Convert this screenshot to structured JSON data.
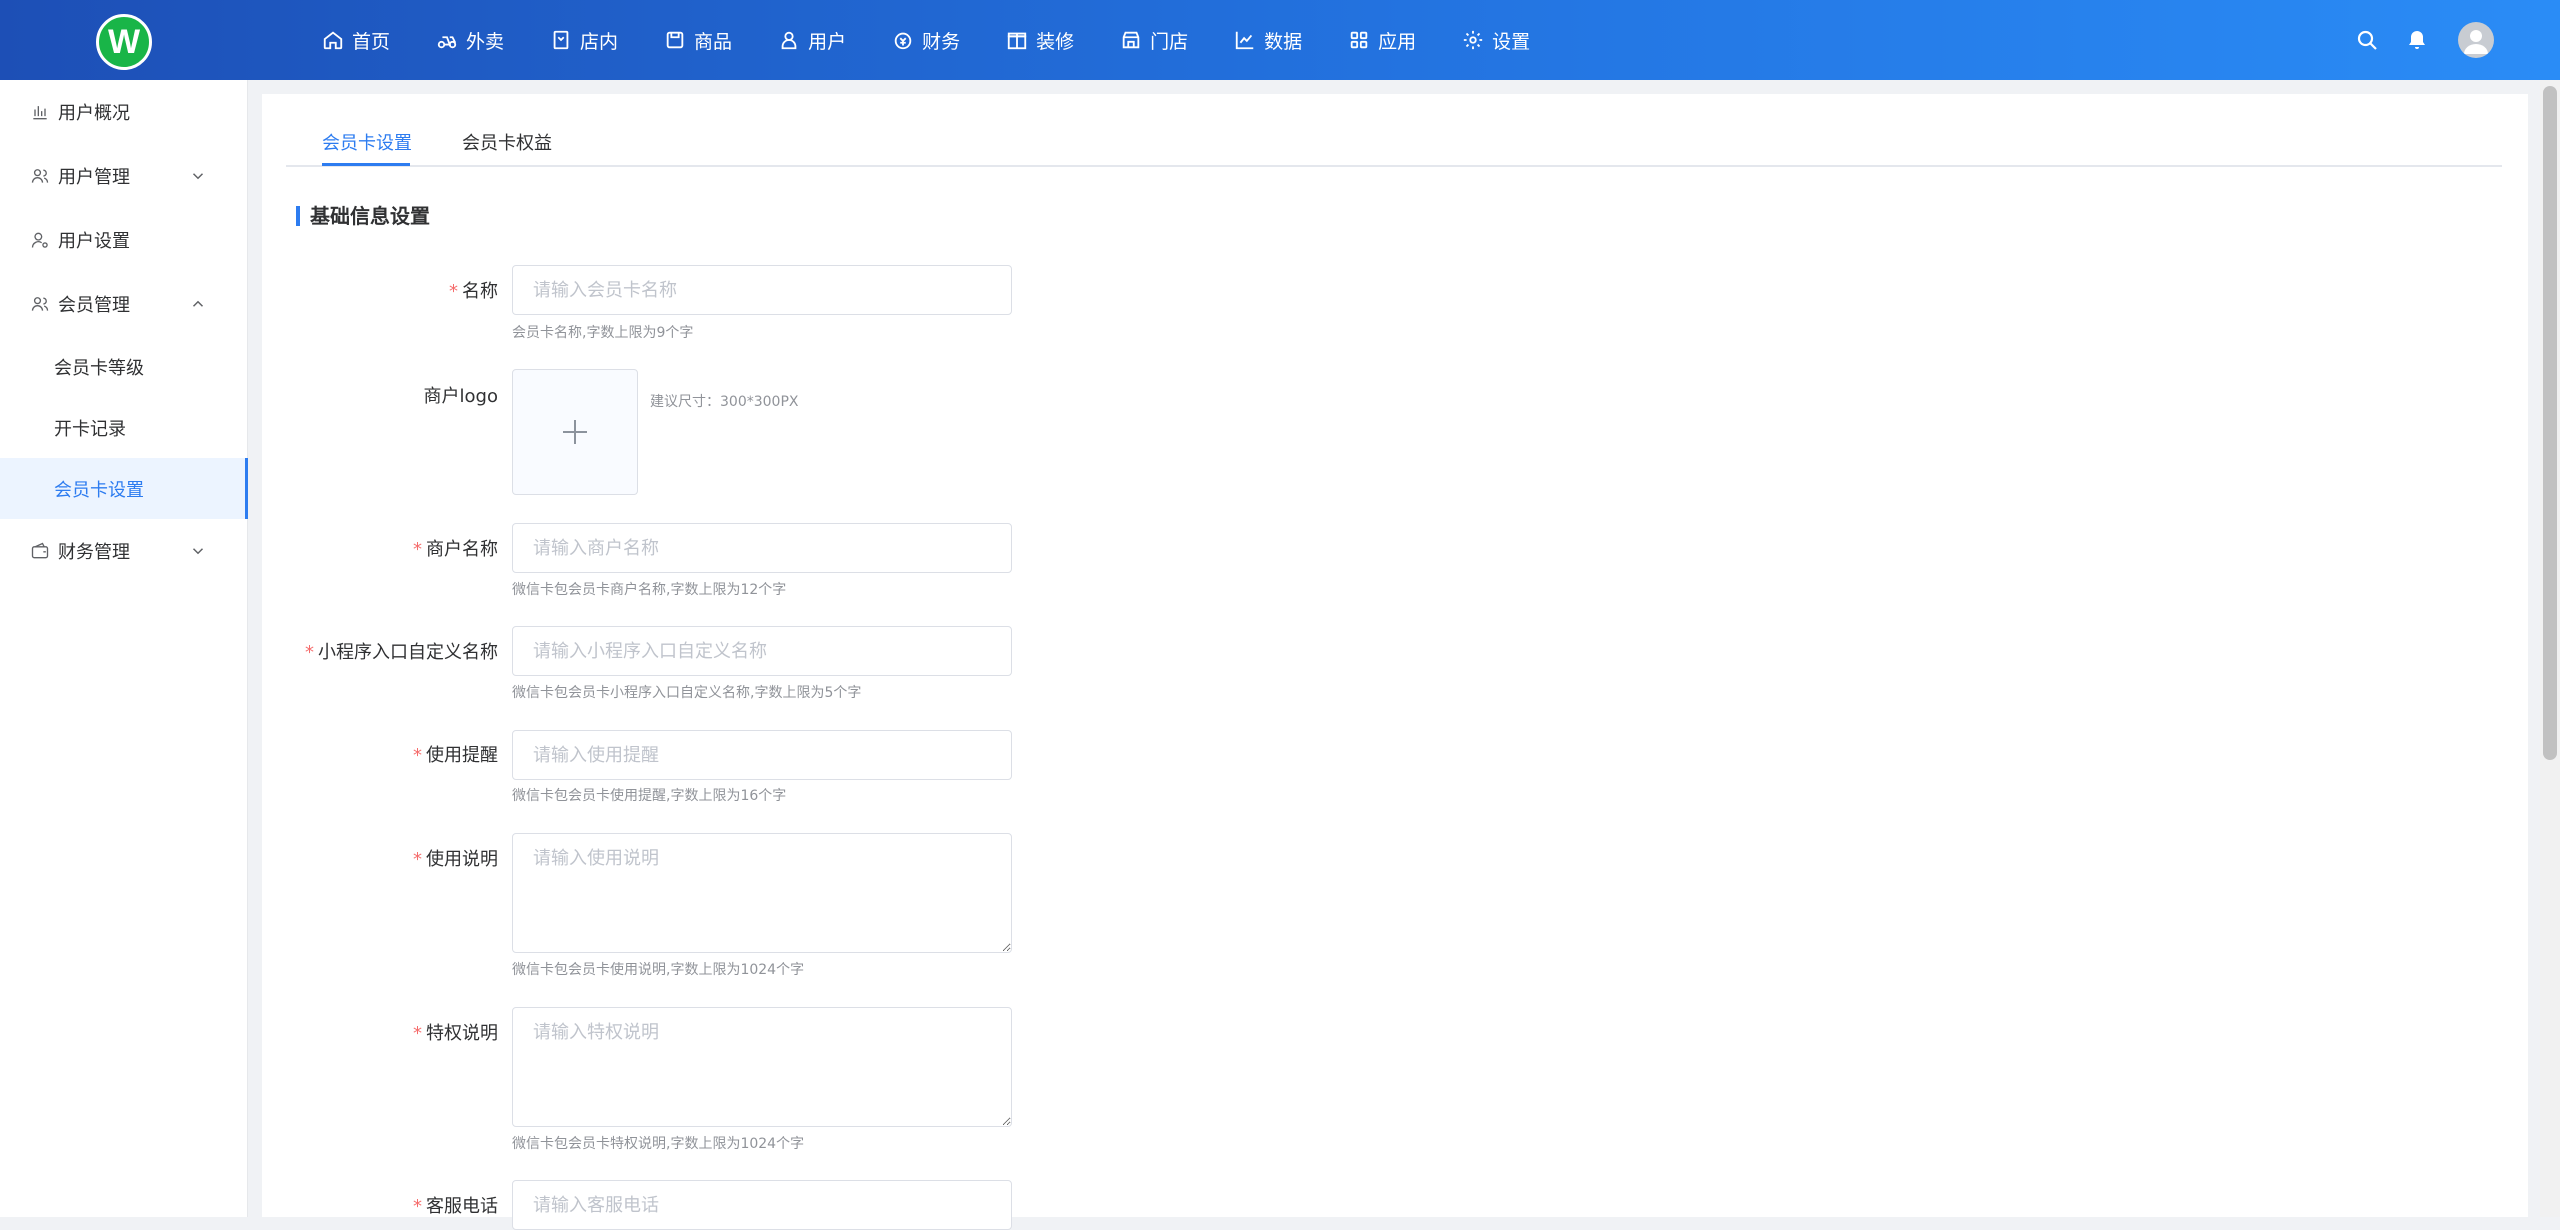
{
  "brand": {
    "logo_letter": "W",
    "logo_color": "#19b548"
  },
  "topnav": [
    {
      "label": "首页",
      "icon": "home-icon"
    },
    {
      "label": "外卖",
      "icon": "takeout-icon"
    },
    {
      "label": "店内",
      "icon": "dine-in-icon"
    },
    {
      "label": "商品",
      "icon": "goods-icon"
    },
    {
      "label": "用户",
      "icon": "user-icon"
    },
    {
      "label": "财务",
      "icon": "finance-icon"
    },
    {
      "label": "装修",
      "icon": "decorate-icon"
    },
    {
      "label": "门店",
      "icon": "store-icon"
    },
    {
      "label": "数据",
      "icon": "chart-icon"
    },
    {
      "label": "应用",
      "icon": "apps-icon"
    },
    {
      "label": "设置",
      "icon": "gear-icon"
    }
  ],
  "sidebar": {
    "items": [
      {
        "label": "用户概况"
      },
      {
        "label": "用户管理"
      },
      {
        "label": "用户设置"
      },
      {
        "label": "会员管理"
      },
      {
        "label": "财务管理"
      }
    ],
    "member_sub": [
      {
        "label": "会员卡等级"
      },
      {
        "label": "开卡记录"
      },
      {
        "label": "会员卡设置"
      }
    ]
  },
  "tabs": [
    {
      "label": "会员卡设置",
      "active": true
    },
    {
      "label": "会员卡权益",
      "active": false
    }
  ],
  "section_title": "基础信息设置",
  "form": {
    "name": {
      "label": "名称",
      "placeholder": "请输入会员卡名称",
      "hint": "会员卡名称,字数上限为9个字"
    },
    "logo": {
      "label": "商户logo",
      "tip": "建议尺寸：300*300PX"
    },
    "merchant": {
      "label": "商户名称",
      "placeholder": "请输入商户名称",
      "hint": "微信卡包会员卡商户名称,字数上限为12个字"
    },
    "entry": {
      "label": "小程序入口自定义名称",
      "placeholder": "请输入小程序入口自定义名称",
      "hint": "微信卡包会员卡小程序入口自定义名称,字数上限为5个字"
    },
    "notice": {
      "label": "使用提醒",
      "placeholder": "请输入使用提醒",
      "hint": "微信卡包会员卡使用提醒,字数上限为16个字"
    },
    "usage": {
      "label": "使用说明",
      "placeholder": "请输入使用说明",
      "hint": "微信卡包会员卡使用说明,字数上限为1024个字"
    },
    "privilege": {
      "label": "特权说明",
      "placeholder": "请输入特权说明",
      "hint": "微信卡包会员卡特权说明,字数上限为1024个字"
    },
    "phone": {
      "label": "客服电话",
      "placeholder": "请输入客服电话"
    }
  },
  "required_mark": "*",
  "accent_color": "#2d7cf0"
}
